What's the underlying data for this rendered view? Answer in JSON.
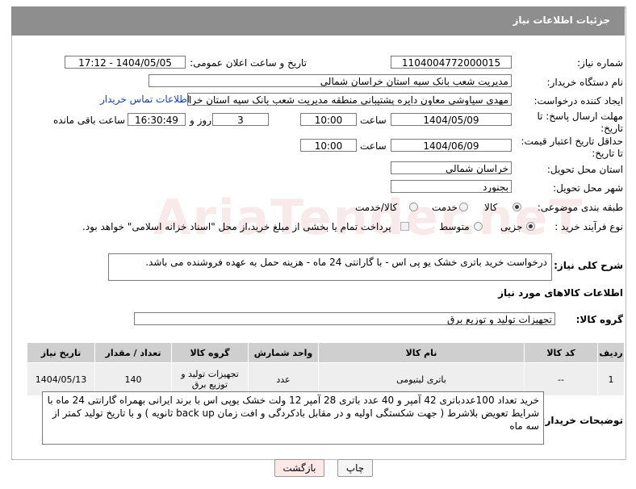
{
  "header": {
    "title": "جزئیات اطلاعات نیاز"
  },
  "form": {
    "need_number_label": "شماره نیاز:",
    "need_number": "1104004772000015",
    "announce_label": "تاریخ و ساعت اعلان عمومی:",
    "announce_value": "1404/05/05 - 17:12",
    "buyer_org_label": "نام دستگاه خریدار:",
    "buyer_org": "مدیریت شعب بانک سپه استان خراسان شمالی",
    "creator_label": "ایجاد کننده درخواست:",
    "creator": "مهدی سیاوشی معاون دایره پشتیبانی منطقه مدیریت شعب بانک سپه استان خراسان",
    "contact_link": "اطلاعات تماس خریدار",
    "reply_deadline_label": "مهلت ارسال پاسخ: تا تاریخ:",
    "reply_date": "1404/05/09",
    "time_label": "ساعت",
    "reply_time": "10:00",
    "days": "3",
    "days_label": "روز و",
    "remaining_time": "16:30:49",
    "remaining_label": "ساعت باقی مانده",
    "price_deadline_label": "حداقل تاریخ اعتبار قیمت: تا تاریخ:",
    "price_date": "1404/06/09",
    "price_time": "10:00",
    "province_label": "استان محل تحویل:",
    "province": "خراسان شمالی",
    "city_label": "شهر محل تحویل:",
    "city": "بجنورد",
    "category_label": "طبقه بندی موضوعی:",
    "category_options": [
      "کالا",
      "خدمت",
      "کالا/خدمت"
    ],
    "category_selected": "کالا",
    "process_label": "نوع فرآیند خرید :",
    "process_options": [
      "جزیی",
      "متوسط"
    ],
    "process_selected": "جزیی",
    "payment_note": "پرداخت تمام یا بخشی از مبلغ خرید،از محل \"اسناد خزانه اسلامی\" خواهد بود."
  },
  "description": {
    "label": "شرح کلی نیاز:",
    "text": "درخواست خرید باتری خشک یو پی اس - با گارانتی 24 ماه - هزینه حمل به عهده فروشنده می باشد."
  },
  "goods": {
    "section_title": "اطلاعات کالاهای مورد نیاز",
    "group_label": "گروه کالا:",
    "group_value": "تجهیزات تولید و توزیع برق",
    "columns": [
      "ردیف",
      "کد کالا",
      "نام کالا",
      "واحد شمارش",
      "گروه کالا",
      "تعداد / مقدار",
      "تاریخ نیاز"
    ],
    "rows": [
      [
        "1",
        "--",
        "باتری لیتیومی",
        "عدد",
        "تجهیزات تولید و توزیع برق",
        "140",
        "1404/05/13"
      ]
    ]
  },
  "buyer_notes": {
    "label": "توضیحات خریدار:",
    "text": "خرید تعداد 100عددباتری  42 آمپر  و 40 عدد باتری 28 آمپر  12 ولت خشک یوپی اس با برند ایرانی بهمراه گارانتی 24 ماه با شرایط تعویض بلاشرط ( جهت شکستگی اولیه و در مقابل بادکردگی و افت زمان back up ثانویه ) و با تاریخ تولید کمتر از سه ماه"
  },
  "buttons": {
    "print": "چاپ",
    "back": "بازگشت"
  },
  "colors": {
    "header_bg": "#8e8e8e",
    "link": "#1a3fb4",
    "back_button_bg": "#fde8e8"
  }
}
